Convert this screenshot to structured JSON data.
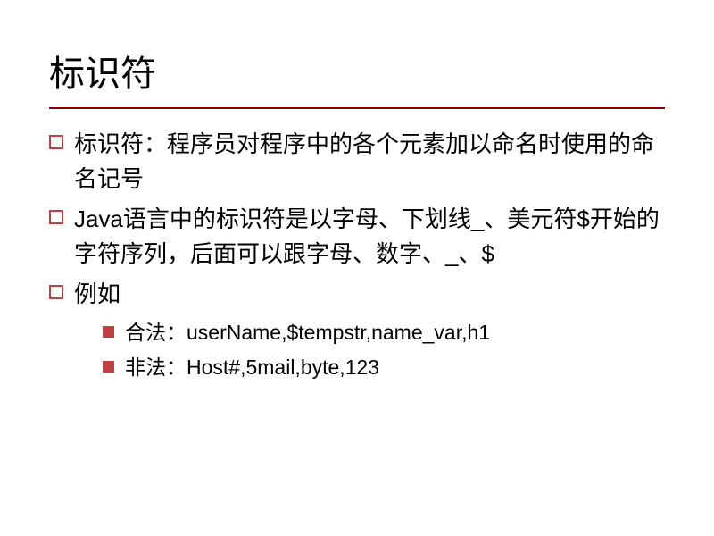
{
  "title": "标识符",
  "bullets": [
    {
      "text": "标识符：程序员对程序中的各个元素加以命名时使用的命名记号"
    },
    {
      "text": "Java语言中的标识符是以字母、下划线_、美元符$开始的字符序列，后面可以跟字母、数字、_、$"
    },
    {
      "text": "例如"
    }
  ],
  "sub_bullets": [
    {
      "text": "合法：userName,$tempstr,name_var,h1"
    },
    {
      "text": "非法：Host#,5mail,byte,123"
    }
  ]
}
